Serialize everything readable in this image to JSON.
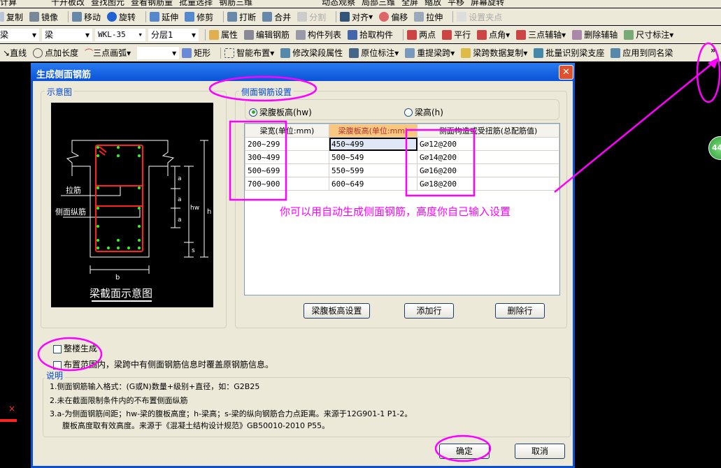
{
  "toolbar_row0": [
    "计算",
    "十开板改",
    "查找图元",
    "查看钢筋量",
    "批量选择",
    "钢筋三维",
    "动态观察",
    "局部三维",
    "全屏",
    "缩放",
    "平移",
    "屏幕旋转"
  ],
  "toolbar_row1": [
    "复制",
    "镜像",
    "移动",
    "旋转",
    "延伸",
    "修剪",
    "打断",
    "合并",
    "分割",
    "对齐",
    "偏移",
    "拉伸",
    "设置夹点"
  ],
  "toolbar_row2": {
    "selects": [
      "梁",
      "梁",
      "WKL-35",
      "分层1"
    ],
    "items": [
      "属性",
      "编辑钢筋",
      "构件列表",
      "拾取构件",
      "两点",
      "平行",
      "点角",
      "三点辅轴",
      "删除辅轴",
      "尺寸标注"
    ]
  },
  "toolbar_row3": {
    "items": [
      "直线",
      "点加长度",
      "三点画弧",
      "矩形",
      "智能布置",
      "修改梁段属性",
      "原位标注",
      "重提梁跨",
      "梁跨数据复制",
      "批量识别梁支座",
      "应用到同名梁"
    ],
    "more": "»"
  },
  "dialog": {
    "title": "生成侧面钢筋",
    "diagram_group": "示意图",
    "diagram": {
      "tie": "拉筋",
      "side_bar": "侧面纵筋",
      "a": "a",
      "hw": "hw",
      "h": "h",
      "s": "s",
      "b": "b",
      "caption": "梁截面示意图"
    },
    "settings_group": "侧面钢筋设置",
    "radio_hw": "梁腹板高(hw)",
    "radio_h": "梁高(h)",
    "radio_selected": "hw",
    "table": {
      "headers": [
        "梁宽(单位:mm)",
        "梁腹板高(单位:mm)",
        "侧面构造或受扭筋(总配筋值)"
      ],
      "rows": [
        [
          "200~299",
          "450~499",
          "G⌀12@200"
        ],
        [
          "300~499",
          "500~549",
          "G⌀14@200"
        ],
        [
          "500~699",
          "550~599",
          "G⌀16@200"
        ],
        [
          "700~900",
          "600~649",
          "G⌀18@200"
        ]
      ]
    },
    "btn_web_height": "梁腹板高设置",
    "btn_add_row": "添加行",
    "btn_delete_row": "删除行",
    "chk_whole": "整楼生成",
    "chk_overwrite": "布置范围内，梁跨中有侧面钢筋信息时覆盖原钢筋信息。",
    "notes_label": "说明",
    "notes": [
      "1.侧面钢筋输入格式：(G或N)数量+级别+直径，如：G2B25",
      "2.未在截面限制条件内的不布置侧面纵筋",
      "3.a-为侧面钢筋间距；hw-梁的腹板高度；h-梁高；s-梁的纵向钢筋合力点距离。来源于12G901-1 P1-2。",
      "腹板高度取有效高度。来源于《混凝土结构设计规范》GB50010-2010 P55。"
    ],
    "ok": "确定",
    "cancel": "取消"
  },
  "annotation": "你可以用自动生成侧面钢筋，高度你自己输入设置",
  "badge": "44",
  "colors": {
    "annotation": "#ff00ff",
    "titlebar": "#0a52d8",
    "rebar": "#ff2020",
    "bar_dot": "#22ff22"
  }
}
